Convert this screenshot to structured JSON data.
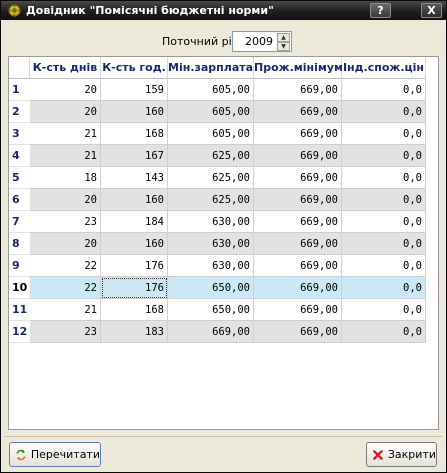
{
  "window": {
    "title": "Довідник \"Помісячні бюджетні норми\"",
    "help_glyph": "?",
    "close_glyph": "X"
  },
  "year_filter": {
    "label": "Поточний рік",
    "value": "2009",
    "spin_up": "▲",
    "spin_down": "▼"
  },
  "table": {
    "columns": [
      "К-сть днів",
      "К-сть год.",
      "Мін.зарплата",
      "Прож.мінімум",
      "Інд.спож.цін"
    ],
    "rows": [
      {
        "num": "1",
        "cells": [
          "20",
          "159",
          "605,00",
          "669,00",
          "0,0"
        ]
      },
      {
        "num": "2",
        "cells": [
          "20",
          "160",
          "605,00",
          "669,00",
          "0,0"
        ]
      },
      {
        "num": "3",
        "cells": [
          "21",
          "168",
          "605,00",
          "669,00",
          "0,0"
        ]
      },
      {
        "num": "4",
        "cells": [
          "21",
          "167",
          "625,00",
          "669,00",
          "0,0"
        ]
      },
      {
        "num": "5",
        "cells": [
          "18",
          "143",
          "625,00",
          "669,00",
          "0,0"
        ]
      },
      {
        "num": "6",
        "cells": [
          "20",
          "160",
          "625,00",
          "669,00",
          "0,0"
        ]
      },
      {
        "num": "7",
        "cells": [
          "23",
          "184",
          "630,00",
          "669,00",
          "0,0"
        ]
      },
      {
        "num": "8",
        "cells": [
          "20",
          "160",
          "630,00",
          "669,00",
          "0,0"
        ]
      },
      {
        "num": "9",
        "cells": [
          "22",
          "176",
          "630,00",
          "669,00",
          "0,0"
        ]
      },
      {
        "num": "10",
        "cells": [
          "22",
          "176",
          "650,00",
          "669,00",
          "0,0"
        ]
      },
      {
        "num": "11",
        "cells": [
          "21",
          "168",
          "650,00",
          "669,00",
          "0,0"
        ]
      },
      {
        "num": "12",
        "cells": [
          "23",
          "183",
          "669,00",
          "669,00",
          "0,0"
        ]
      }
    ],
    "selected_row": 10
  },
  "buttons": {
    "reload_label": "Перечитати",
    "close_label": "Закрити"
  },
  "icons": {
    "app": "app-gear-icon",
    "reload": "reload-arrows-icon",
    "close": "red-x-icon"
  },
  "colors": {
    "selected_row": "#cce8f5",
    "alt_row": "#e2e2e2",
    "header_text": "#1a2a6a"
  }
}
